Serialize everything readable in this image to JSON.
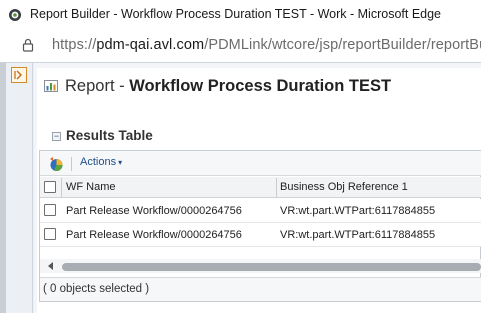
{
  "window": {
    "title": "Report Builder - Workflow Process Duration TEST - Work - Microsoft Edge"
  },
  "addressbar": {
    "url_prefix": "https://",
    "url_host": "pdm-qai.avl.com",
    "url_path": "/PDMLink/wtcore/jsp/reportBuilder/reportBui"
  },
  "report": {
    "label": "Report - ",
    "name": "Workflow Process Duration TEST"
  },
  "results": {
    "section_title": "Results Table",
    "toolbar": {
      "actions_label": "Actions",
      "actions_caret": "▾"
    },
    "columns": [
      "WF Name",
      "Business Obj Reference 1"
    ],
    "rows": [
      {
        "wf_name": "Part Release Workflow/0000264756",
        "business_ref": "VR:wt.part.WTPart:6117884855"
      },
      {
        "wf_name": "Part Release Workflow/0000264756",
        "business_ref": "VR:wt.part.WTPart:6117884855"
      }
    ],
    "status": "( 0 objects selected )"
  },
  "icons": {
    "app": "edge-app-icon",
    "lock": "lock-icon",
    "expand": "expand-panel-icon",
    "report": "bar-chart-icon",
    "collapse": "collapse-icon",
    "table_tool": "table-options-icon",
    "scroll_left": "scroll-left-icon"
  },
  "colors": {
    "accent_link": "#1f4f8a",
    "expand_border": "#d08a2a"
  }
}
